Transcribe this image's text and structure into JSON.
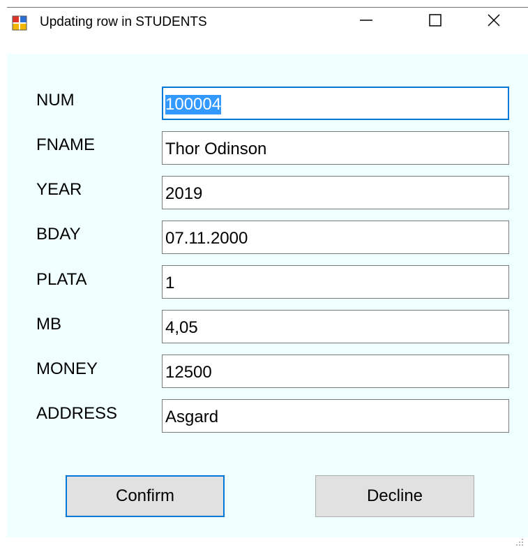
{
  "window": {
    "title": "Updating row in STUDENTS",
    "icon": "form-app-icon",
    "controls": {
      "minimize": "minimize-icon",
      "maximize": "maximize-icon",
      "close": "close-icon"
    }
  },
  "fields": [
    {
      "label": "NUM",
      "value": "100004",
      "focused": true,
      "selected": true
    },
    {
      "label": "FNAME",
      "value": "Thor Odinson"
    },
    {
      "label": "YEAR",
      "value": "2019"
    },
    {
      "label": "BDAY",
      "value": "07.11.2000"
    },
    {
      "label": "PLATA",
      "value": "1"
    },
    {
      "label": "MB",
      "value": "4,05"
    },
    {
      "label": "MONEY",
      "value": "12500"
    },
    {
      "label": "ADDRESS",
      "value": "Asgard"
    }
  ],
  "buttons": {
    "confirm": "Confirm",
    "decline": "Decline"
  },
  "colors": {
    "client_background": "#f0ffff",
    "focus_accent": "#0078d7",
    "selection": "#3399ff",
    "button_face": "#e1e1e1"
  }
}
